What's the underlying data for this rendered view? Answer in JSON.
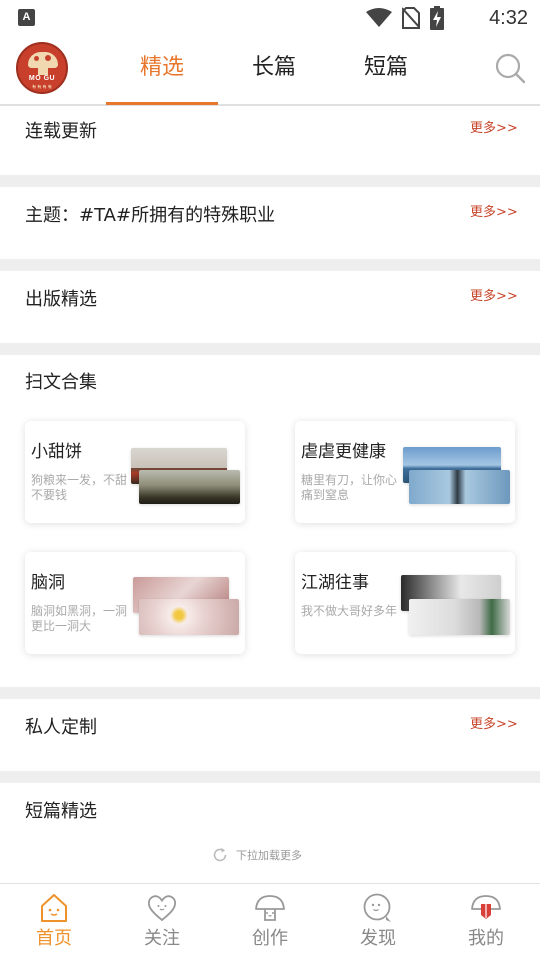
{
  "status_bar": {
    "indicator": "A",
    "time": "4:32",
    "icons": [
      "wifi-icon",
      "no-sim-icon",
      "battery-charging-icon"
    ]
  },
  "header": {
    "logo_text": "MO GU",
    "logo_subtext": "有 有 有 有",
    "tabs": [
      {
        "label": "精选",
        "active": true
      },
      {
        "label": "长篇",
        "active": false
      },
      {
        "label": "短篇",
        "active": false
      }
    ],
    "search_icon": "search-icon"
  },
  "sections": {
    "serial": {
      "title": "连载更新",
      "more": "更多>>"
    },
    "theme": {
      "title": "主题：#TA#所拥有的特殊职业",
      "more": "更多>>"
    },
    "published": {
      "title": "出版精选",
      "more": "更多>>"
    },
    "collections": {
      "title": "扫文合集",
      "cards": [
        {
          "title": "小甜饼",
          "desc": "狗粮来一发，不甜不要钱"
        },
        {
          "title": "虐虐更健康",
          "desc": "糖里有刀，让你心痛到窒息"
        },
        {
          "title": "脑洞",
          "desc": "脑洞如黑洞，一洞更比一洞大"
        },
        {
          "title": "江湖往事",
          "desc": "我不做大哥好多年"
        }
      ]
    },
    "custom": {
      "title": "私人定制",
      "more": "更多>>"
    },
    "short": {
      "title": "短篇精选"
    }
  },
  "load_more": "下拉加载更多",
  "bottom_nav": [
    {
      "label": "首页",
      "icon": "home-icon",
      "active": true
    },
    {
      "label": "关注",
      "icon": "heart-icon",
      "active": false
    },
    {
      "label": "创作",
      "icon": "mushroom-icon",
      "active": false
    },
    {
      "label": "发现",
      "icon": "discover-icon",
      "active": false
    },
    {
      "label": "我的",
      "icon": "profile-icon",
      "active": false
    }
  ],
  "colors": {
    "accent": "#e8772e",
    "more_link": "#c8442a",
    "separator": "#eeeeee",
    "nav_active": "#f0922b"
  }
}
